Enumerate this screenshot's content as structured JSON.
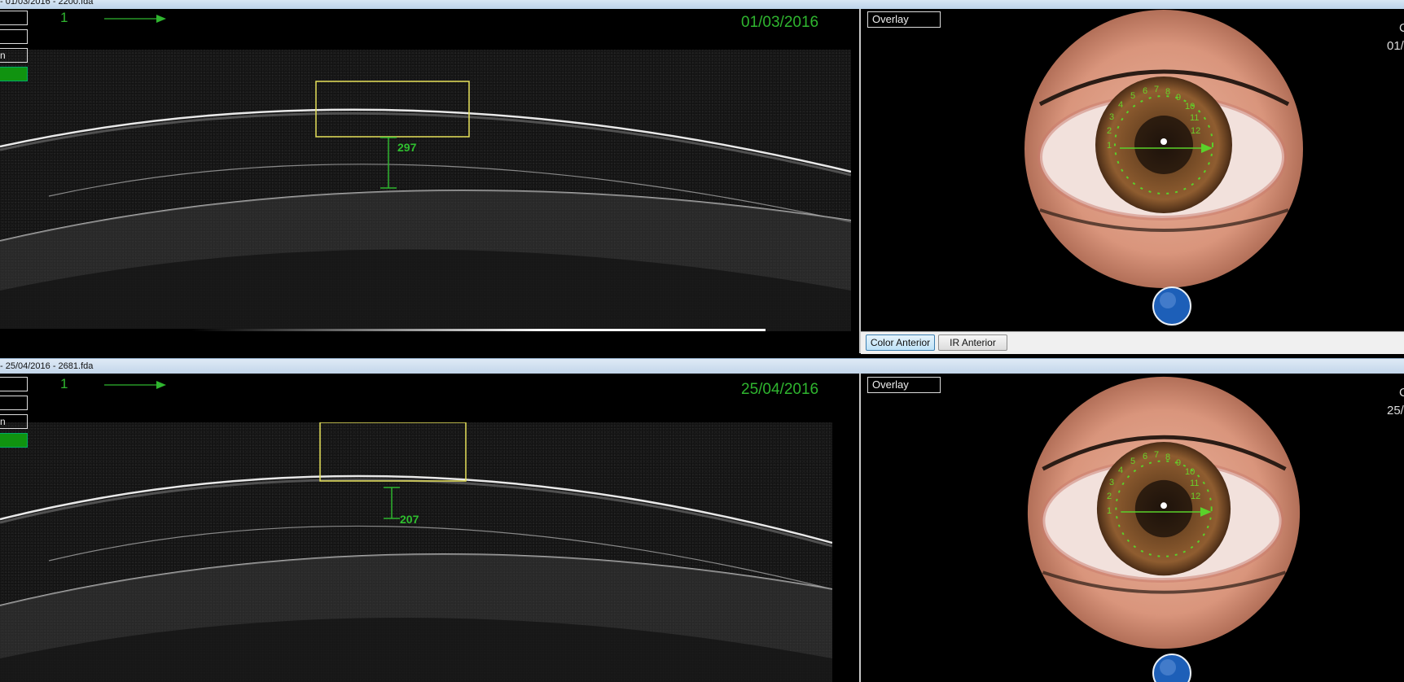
{
  "top": {
    "title": "- 01/03/2016 - 2200.fda",
    "date": "01/03/2016",
    "scan_number": "1",
    "measurement": "297",
    "side_panel": [
      "",
      "",
      "n",
      ""
    ],
    "fundus_right_text_1": "C",
    "fundus_right_text_2": "01/"
  },
  "bottom": {
    "title": "- 25/04/2016 - 2681.fda",
    "date": "25/04/2016",
    "scan_number": "1",
    "measurement": "207",
    "side_panel": [
      "",
      "",
      "n",
      ""
    ],
    "fundus_right_text_1": "C",
    "fundus_right_text_2": "25/"
  },
  "overlay_label": "Overlay",
  "buttons": {
    "color_anterior": "Color Anterior",
    "ir_anterior": "IR Anterior"
  },
  "clock_numbers": [
    "1",
    "2",
    "3",
    "4",
    "5",
    "6",
    "7",
    "8",
    "9",
    "10",
    "11",
    "12"
  ],
  "colors": {
    "accent_green": "#2fb52f",
    "roi_yellow": "#e6e15a",
    "indicator_blue": "#1d5fb8"
  },
  "icons": {
    "scan_direction": "right-arrow-icon",
    "fixation": "blue-circle-icon",
    "scroll": "triangle-right-icon"
  }
}
